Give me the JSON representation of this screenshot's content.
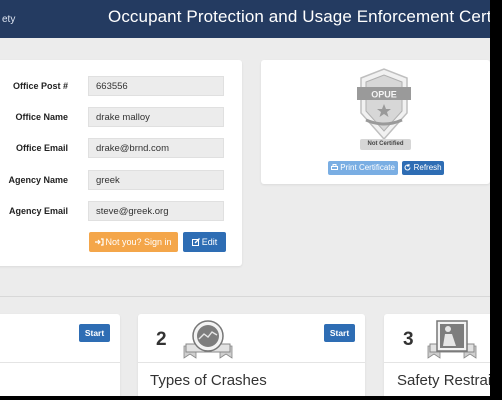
{
  "header": {
    "brand_cut": "ety",
    "title": "Occupant Protection and Usage Enforcement Certification"
  },
  "profile": {
    "fields": [
      {
        "label": "Office Post #",
        "value": "663556"
      },
      {
        "label": "Office Name",
        "value": "drake malloy"
      },
      {
        "label": "Office Email",
        "value": "drake@brnd.com"
      },
      {
        "label": "Agency Name",
        "value": "greek"
      },
      {
        "label": "Agency Email",
        "value": "steve@greek.org"
      }
    ],
    "signin_label": "Not you? Sign in",
    "edit_label": "Edit"
  },
  "certificate": {
    "badge_text": "OPUE",
    "status": "Not Certified",
    "print_label": "Print Certificate",
    "refresh_label": "Refresh"
  },
  "modules": [
    {
      "number": "",
      "title": "",
      "start_label": "Start"
    },
    {
      "number": "2",
      "title": "Types of Crashes",
      "start_label": "Start"
    },
    {
      "number": "3",
      "title": "Safety Restraints",
      "start_label": ""
    }
  ],
  "colors": {
    "header": "#243b61",
    "primary": "#2e6db4",
    "warning": "#f4a64a",
    "background": "#ececec"
  }
}
